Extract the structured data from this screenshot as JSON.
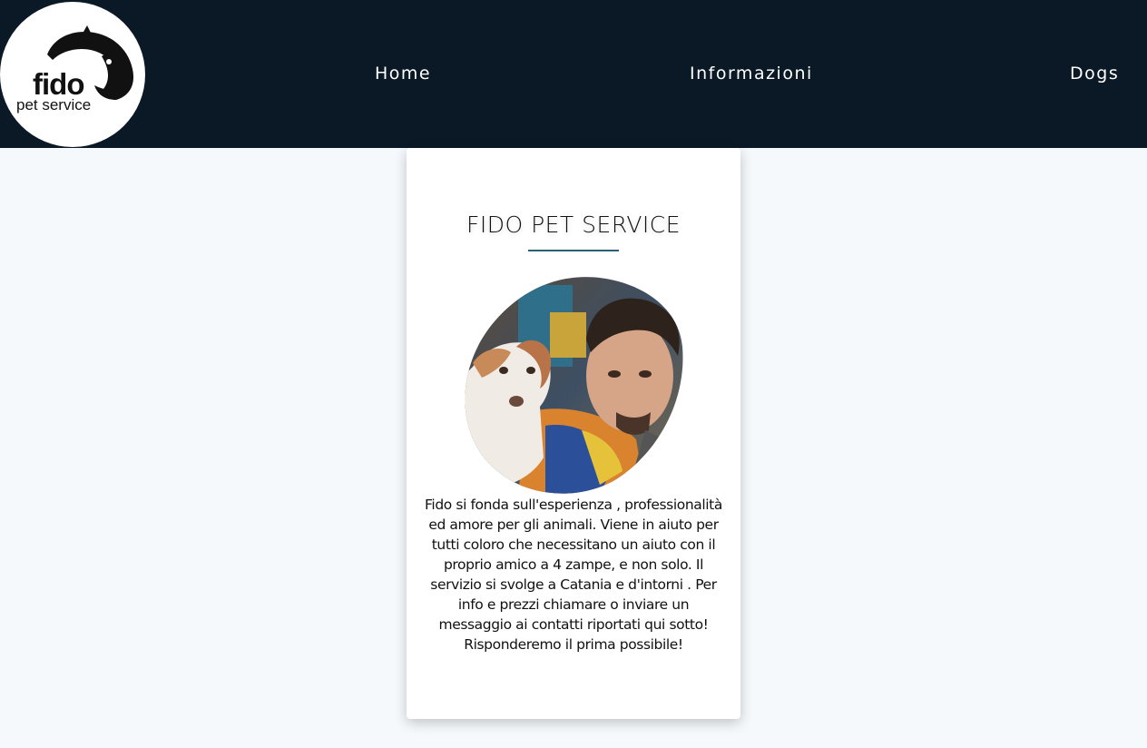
{
  "logo": {
    "word": "fido",
    "sub": "pet service"
  },
  "nav": {
    "home": "Home",
    "info": "Informazioni",
    "dogs": "Dogs"
  },
  "card": {
    "title": "FIDO PET SERVICE",
    "description": "Fido si fonda sull'esperienza , professionalità ed amore per gli animali. Viene in aiuto per tutti coloro che necessitano un aiuto con il proprio amico a 4 zampe, e non solo. Il servizio si svolge a Catania e d'intorni . Per info e prezzi chiamare o inviare un messaggio ai contatti riportati qui sotto! Risponderemo il prima possibile!"
  },
  "colors": {
    "navbar": "#0b1826",
    "accent_rule": "#2a6173",
    "page_bg": "#f5f9fc"
  }
}
